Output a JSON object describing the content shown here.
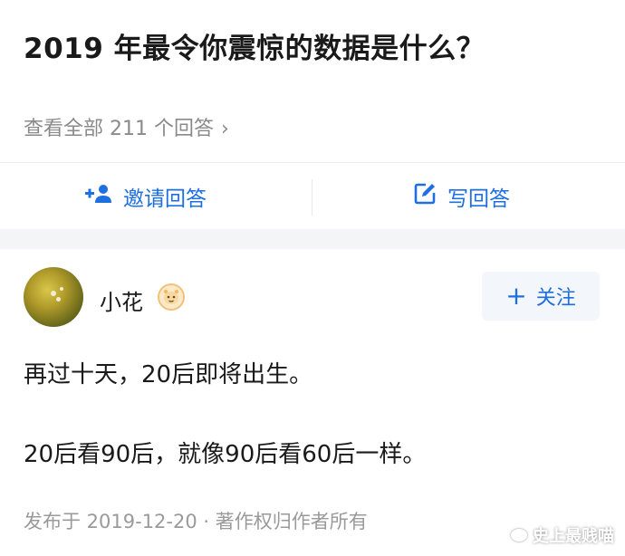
{
  "question": {
    "title": "2019 年最令你震惊的数据是什么？",
    "view_all": "查看全部 211 个回答",
    "chevron": "›"
  },
  "actions": {
    "invite_label": "邀请回答",
    "write_label": "写回答",
    "accent_color": "#1e6fe0"
  },
  "answer": {
    "author": {
      "name": "小花",
      "avatar_icon": "avatar-photo",
      "badge_icon": "emoji-badge-icon"
    },
    "follow_label": "关注",
    "follow_icon": "+",
    "paragraphs": [
      "再过十天，20后即将出生。",
      "20后看90后，就像90后看60后一样。"
    ],
    "meta": "发布于 2019-12-20 · 著作权归作者所有"
  },
  "watermark": {
    "text": "史上最贱喵"
  }
}
